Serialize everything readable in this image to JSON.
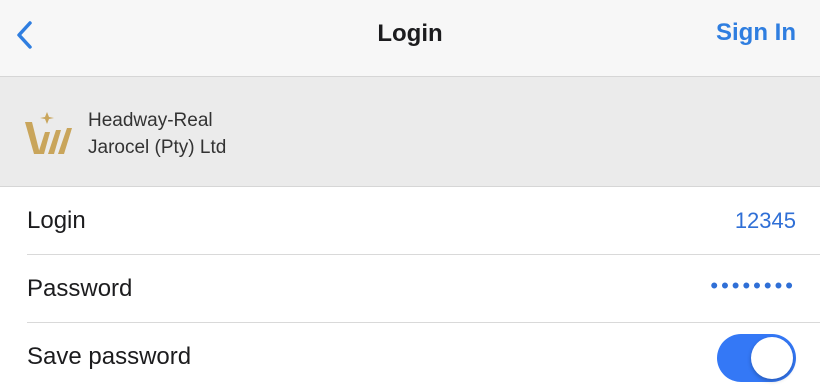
{
  "nav": {
    "back_icon": "chevron-left-icon",
    "title": "Login",
    "action_label": "Sign In",
    "accent_color": "#2f7ee0"
  },
  "server": {
    "logo_icon": "company-logo-icon",
    "name_line1": "Headway-Real",
    "name_line2": "Jarocel (Pty) Ltd"
  },
  "form": {
    "login": {
      "label": "Login",
      "value": "12345"
    },
    "password": {
      "label": "Password",
      "value": "••••••••"
    },
    "save_password": {
      "label": "Save password",
      "enabled": true,
      "toggle_color": "#3478f6"
    }
  }
}
